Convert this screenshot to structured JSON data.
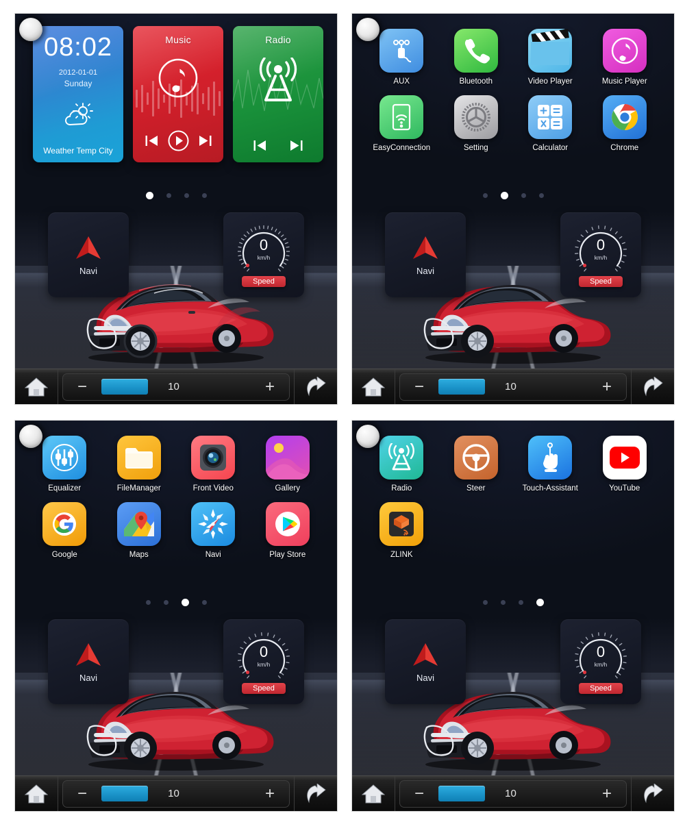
{
  "device": {
    "name": "Android car head unit home screen",
    "screens": 4,
    "background_color": "#0c1019"
  },
  "taskbar": {
    "home_icon": "home-icon",
    "back_icon": "back-arrow-icon",
    "volume": {
      "minus_label": "−",
      "plus_label": "+",
      "value": "10",
      "fill_color": "#1b93c9"
    }
  },
  "widgets_page": {
    "clock": {
      "time": "08:02",
      "date": "2012-01-01",
      "day": "Sunday",
      "weather_icon": "sun-cloud-icon",
      "footer": "Weather  Temp  City",
      "color": "#2f84d0"
    },
    "music": {
      "title": "Music",
      "icon": "music-note-icon",
      "prev_icon": "skip-previous-icon",
      "play_icon": "play-icon",
      "next_icon": "skip-next-icon",
      "color": "#cf1f2a"
    },
    "radio": {
      "title": "Radio",
      "icon": "radio-tower-icon",
      "prev_icon": "skip-previous-icon",
      "next_icon": "skip-next-icon",
      "color": "#19903a"
    }
  },
  "dock": {
    "navi": {
      "label": "Navi",
      "icon": "navigation-arrow-icon",
      "color": "#e02020"
    },
    "speed": {
      "value": "0",
      "unit": "km/h",
      "button_label": "Speed",
      "button_color": "#c02730"
    }
  },
  "pages": [
    {
      "index": 1,
      "type": "widgets",
      "dots": [
        true,
        false,
        false,
        false
      ]
    },
    {
      "index": 2,
      "type": "apps",
      "dots": [
        false,
        true,
        false,
        false
      ],
      "apps": [
        {
          "label": "AUX",
          "icon": "aux-jack-icon",
          "color": "#59a8ef"
        },
        {
          "label": "Bluetooth",
          "icon": "phone-handset-icon",
          "color": "#4ccc5a"
        },
        {
          "label": "Video Player",
          "icon": "clapperboard-icon",
          "color": "#67c7ee"
        },
        {
          "label": "Music Player",
          "icon": "music-note-icon",
          "color": "#e349c8"
        },
        {
          "label": "EasyConnection",
          "icon": "tablet-wifi-icon",
          "color": "#4ccc7a"
        },
        {
          "label": "Setting",
          "icon": "gear-icon",
          "color": "#b9b9b9"
        },
        {
          "label": "Calculator",
          "icon": "calculator-icon",
          "color": "#63b4f0"
        },
        {
          "label": "Chrome",
          "icon": "chrome-icon",
          "color": "#2e8ce8"
        }
      ]
    },
    {
      "index": 3,
      "type": "apps",
      "dots": [
        false,
        false,
        true,
        false
      ],
      "apps": [
        {
          "label": "Equalizer",
          "icon": "equalizer-sliders-icon",
          "color": "#29a9ee"
        },
        {
          "label": "FileManager",
          "icon": "folder-icon",
          "color": "#f5ad15"
        },
        {
          "label": "Front Video",
          "icon": "camera-lens-icon",
          "color": "#fb5f6d"
        },
        {
          "label": "Gallery",
          "icon": "photo-landscape-icon",
          "color": "#c34ae8"
        },
        {
          "label": "Google",
          "icon": "google-g-icon",
          "color": "#f7b countless"
        },
        {
          "label": "Maps",
          "icon": "google-maps-pin-icon",
          "color": "#3b86f0"
        },
        {
          "label": "Navi",
          "icon": "compass-icon",
          "color": "#29a9ee"
        },
        {
          "label": "Play Store",
          "icon": "play-store-icon",
          "color": "#f5556d"
        }
      ]
    },
    {
      "index": 4,
      "type": "apps",
      "dots": [
        false,
        false,
        false,
        true
      ],
      "apps": [
        {
          "label": "Radio",
          "icon": "radio-tower-icon",
          "color": "#2fc7b0"
        },
        {
          "label": "Steer",
          "icon": "steering-wheel-icon",
          "color": "#d2763f"
        },
        {
          "label": "Touch-Assistant",
          "icon": "touch-hand-icon",
          "color": "#2e9cf5"
        },
        {
          "label": "YouTube",
          "icon": "youtube-icon",
          "color": "#ffffff"
        },
        {
          "label": "ZLINK",
          "icon": "zlink-icon",
          "color": "#f7b game"
        }
      ]
    }
  ]
}
